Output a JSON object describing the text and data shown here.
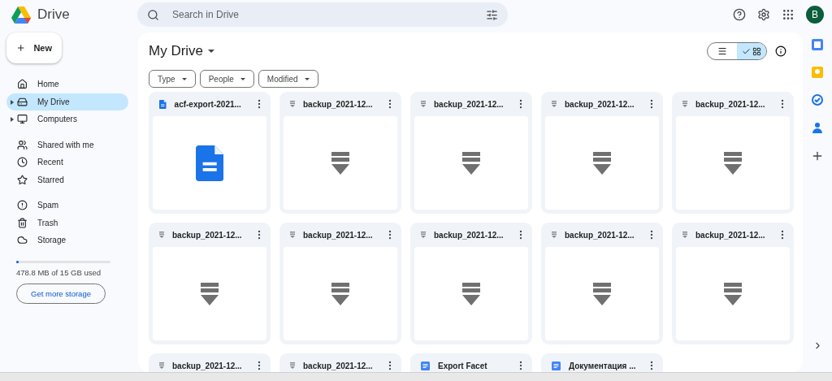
{
  "app": {
    "name": "Drive"
  },
  "search": {
    "placeholder": "Search in Drive"
  },
  "account": {
    "initial": "B"
  },
  "sidebar": {
    "new_button": "New",
    "sections": [
      {
        "items": [
          {
            "label": "Home",
            "selected": false
          },
          {
            "label": "My Drive",
            "selected": true,
            "expanded": false
          },
          {
            "label": "Computers",
            "selected": false,
            "expanded": false
          }
        ]
      },
      {
        "items": [
          {
            "label": "Shared with me",
            "selected": false
          },
          {
            "label": "Recent",
            "selected": false
          },
          {
            "label": "Starred",
            "selected": false
          }
        ]
      },
      {
        "items": [
          {
            "label": "Spam",
            "selected": false
          },
          {
            "label": "Trash",
            "selected": false
          },
          {
            "label": "Storage",
            "selected": false
          }
        ]
      }
    ],
    "storage": {
      "level": 0.03,
      "usage": "478.8 MB of 15 GB used",
      "button": "Get more storage"
    }
  },
  "main": {
    "title": "My Drive",
    "views": [
      {
        "kind": "list",
        "selected": false
      },
      {
        "kind": "grid",
        "selected": true
      }
    ],
    "filters": [
      "Type",
      "People",
      "Modified"
    ],
    "files": [
      {
        "name": "acf-export-2021...",
        "kind": "doc"
      },
      {
        "name": "backup_2021-12...",
        "kind": "archive"
      },
      {
        "name": "backup_2021-12...",
        "kind": "archive"
      },
      {
        "name": "backup_2021-12...",
        "kind": "archive"
      },
      {
        "name": "backup_2021-12...",
        "kind": "archive"
      },
      {
        "name": "backup_2021-12...",
        "kind": "archive"
      },
      {
        "name": "backup_2021-12...",
        "kind": "archive"
      },
      {
        "name": "backup_2021-12...",
        "kind": "archive"
      },
      {
        "name": "backup_2021-12...",
        "kind": "archive"
      },
      {
        "name": "backup_2021-12...",
        "kind": "archive"
      },
      {
        "name": "backup_2021-12...",
        "kind": "archive"
      },
      {
        "name": "backup_2021-12...",
        "kind": "archive"
      },
      {
        "name": "Export Facet",
        "kind": "gdoc"
      },
      {
        "name": "Документация ...",
        "kind": "gdoc"
      }
    ]
  }
}
